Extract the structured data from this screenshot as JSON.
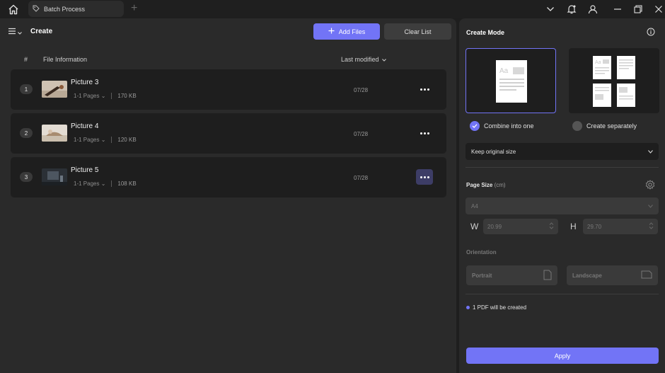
{
  "titlebar": {
    "tab_label": "Batch Process",
    "add_tab_glyph": "+"
  },
  "left": {
    "title": "Create",
    "add_files_label": "Add Files",
    "clear_list_label": "Clear List",
    "columns": {
      "num": "#",
      "info": "File Information",
      "modified": "Last modified"
    },
    "files": [
      {
        "index": "1",
        "name": "Picture 3",
        "pages": "1-1 Pages",
        "size": "170 KB",
        "date": "07/28"
      },
      {
        "index": "2",
        "name": "Picture 4",
        "pages": "1-1 Pages",
        "size": "120 KB",
        "date": "07/28"
      },
      {
        "index": "3",
        "name": "Picture 5",
        "pages": "1-1 Pages",
        "size": "108 KB",
        "date": "07/28"
      }
    ]
  },
  "right": {
    "title": "Create Mode",
    "modes": {
      "combine": "Combine into one",
      "separate": "Create separately",
      "selected": "combine"
    },
    "size_select": "Keep original size",
    "page_size": {
      "label": "Page Size",
      "unit": "(cm)",
      "preset": "A4",
      "w_label": "W",
      "w_value": "20.99",
      "h_label": "H",
      "h_value": "29.70"
    },
    "orientation": {
      "label": "Orientation",
      "portrait": "Portrait",
      "landscape": "Landscape"
    },
    "note": "1 PDF will be created",
    "apply_label": "Apply"
  },
  "colors": {
    "accent": "#7274f6",
    "panel": "#2a2a2a",
    "row": "#1e1e1e"
  }
}
